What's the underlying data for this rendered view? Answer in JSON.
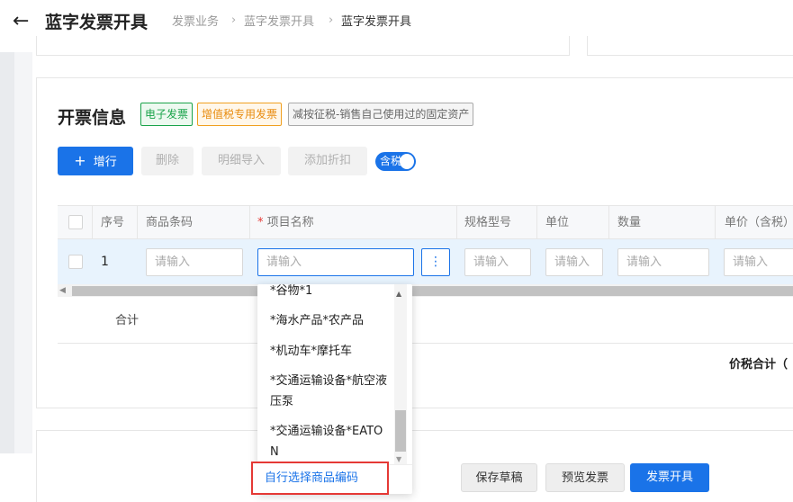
{
  "header": {
    "title": "蓝字发票开具",
    "breadcrumb": [
      "发票业务",
      "蓝字发票开具",
      "蓝字发票开具"
    ]
  },
  "section": {
    "title": "开票信息",
    "tags": [
      "电子发票",
      "增值税专用发票",
      "减按征税-销售自己使用过的固定资产"
    ]
  },
  "toolbar": {
    "add_row": "增行",
    "delete": "删除",
    "detail_import": "明细导入",
    "add_discount": "添加折扣",
    "tax_toggle": "含税"
  },
  "table": {
    "headers": [
      "序号",
      "商品条码",
      "项目名称",
      "规格型号",
      "单位",
      "数量",
      "单价（含税）"
    ],
    "required_mark": "*",
    "rows": [
      {
        "seq": "1",
        "placeholder": "请输入"
      }
    ],
    "total_label": "合计",
    "tax_total_label": "价税合计（"
  },
  "dropdown": {
    "items": [
      "*谷物*1",
      "*海水产品*农产品",
      "*机动车*摩托车",
      "*交通运输设备*航空液压泵",
      "*交通运输设备*EATON"
    ],
    "custom_code_link": "自行选择商品编码"
  },
  "footer": {
    "save_draft": "保存草稿",
    "preview": "预览发票",
    "issue": "发票开具"
  },
  "colors": {
    "primary": "#1a73e8",
    "row_highlight": "#e8f3fd",
    "tag_green": "#1aa34a",
    "tag_orange": "#e88c10",
    "highlight_box": "#e53935"
  }
}
